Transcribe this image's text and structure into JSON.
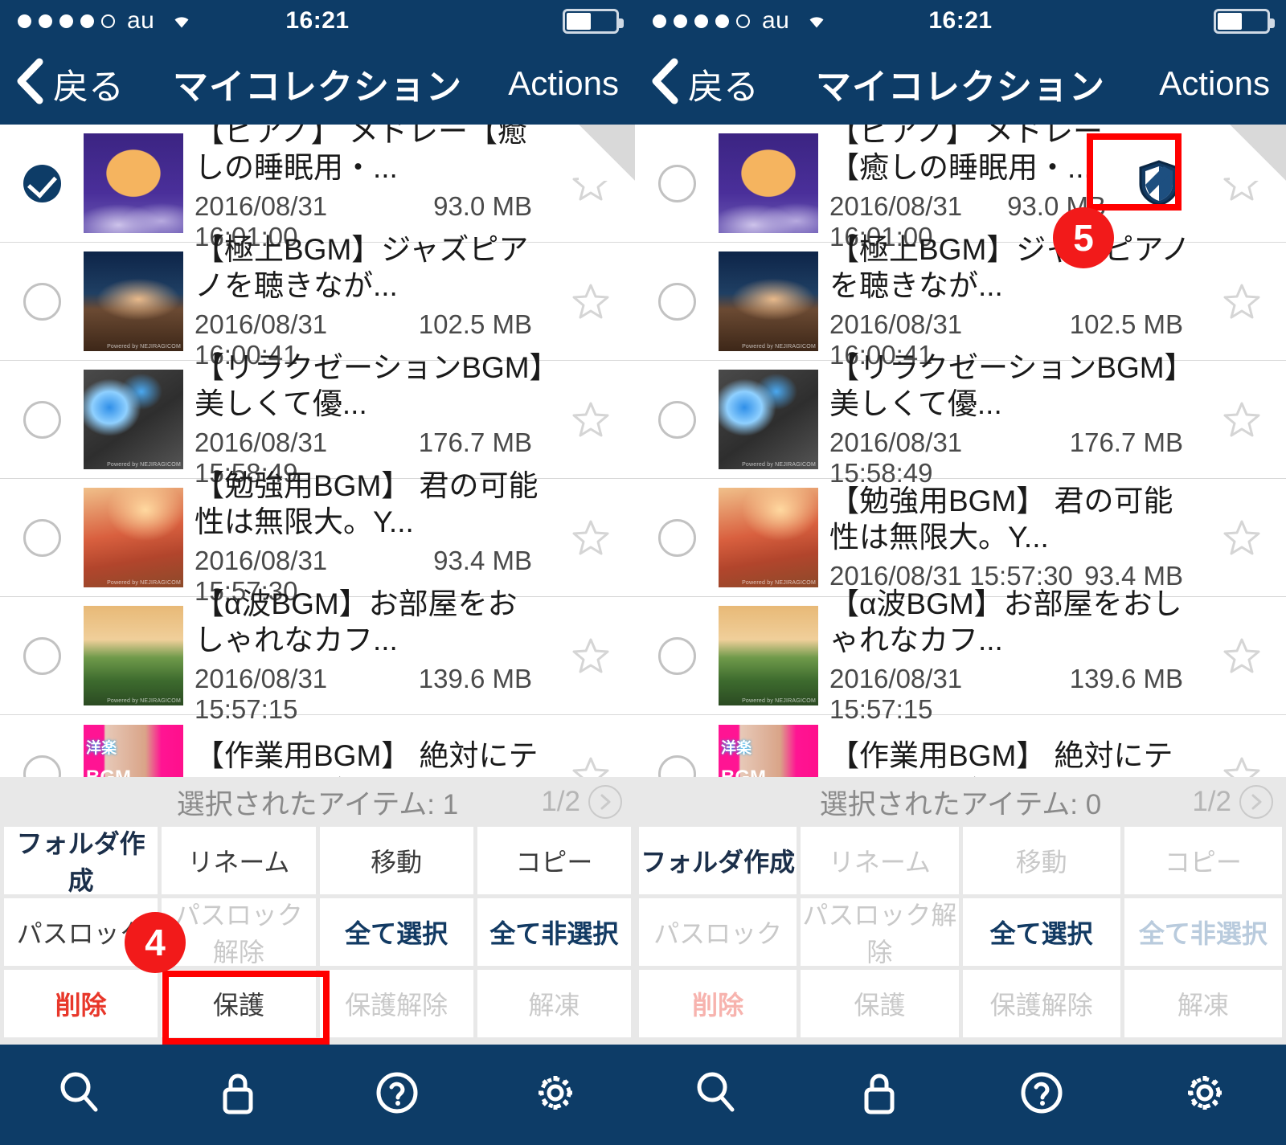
{
  "status_bar": {
    "carrier": "au",
    "time": "16:21",
    "signal_dots_filled": 4,
    "signal_dots_total": 5,
    "battery_percent": 50,
    "wifi_icon": "wifi-icon",
    "battery_icon": "battery-icon"
  },
  "nav": {
    "back_label": "戻る",
    "title": "マイコレクション",
    "actions_label": "Actions",
    "back_icon": "chevron-left-icon"
  },
  "colors": {
    "navy": "#0d3c67",
    "panel_bg": "#e8e8e8",
    "highlight_red": "#ff0000",
    "danger_red": "#e8372a",
    "accent_blue": "#123a63"
  },
  "items": [
    {
      "title": "【ピアノ】 メドレー【癒しの睡眠用・...",
      "date": "2016/08/31 16:01:00",
      "size": "93.0 MB",
      "selected_left": true,
      "selected_right": false,
      "protected_right": true,
      "star_icon": "star-outline-icon",
      "shield_icon": "shield-protected-icon",
      "thumb": "moon-night"
    },
    {
      "title": "【極上BGM】ジャズピアノを聴きなが...",
      "date": "2016/08/31 16:00:41",
      "size": "102.5 MB",
      "selected_left": false,
      "selected_right": false,
      "protected_right": false,
      "star_icon": "star-outline-icon",
      "thumb": "terrace-dusk"
    },
    {
      "title": "【リラクゼーションBGM】美しくて優...",
      "date": "2016/08/31 15:58:49",
      "size": "176.7 MB",
      "selected_left": false,
      "selected_right": false,
      "protected_right": false,
      "star_icon": "star-outline-icon",
      "thumb": "blue-orchid"
    },
    {
      "title": "【勉強用BGM】 君の可能性は無限大。Y...",
      "date": "2016/08/31 15:57:30",
      "size": "93.4 MB",
      "selected_left": false,
      "selected_right": false,
      "protected_right": false,
      "star_icon": "star-outline-icon",
      "thumb": "desk-warm"
    },
    {
      "title": "【α波BGM】お部屋をおしゃれなカフ...",
      "date": "2016/08/31 15:57:15",
      "size": "139.6 MB",
      "selected_left": false,
      "selected_right": false,
      "protected_right": false,
      "star_icon": "star-outline-icon",
      "thumb": "cafe-landscape"
    },
    {
      "title": "【作業用BGM】 絶対にテンションが",
      "date": "",
      "size": "",
      "selected_left": false,
      "selected_right": false,
      "protected_right": false,
      "star_icon": "star-outline-icon",
      "thumb": "pink-idol"
    }
  ],
  "action_panel_left": {
    "count_label": "選択されたアイテム: 1",
    "page_label": "1/2",
    "next_icon": "chevron-right-circle-icon",
    "buttons": [
      {
        "label": "フォルダ作成",
        "state": "bold"
      },
      {
        "label": "リネーム",
        "state": "normal"
      },
      {
        "label": "移動",
        "state": "normal"
      },
      {
        "label": "コピー",
        "state": "normal"
      },
      {
        "label": "パスロック",
        "state": "normal"
      },
      {
        "label": "パスロック解除",
        "state": "dim"
      },
      {
        "label": "全て選択",
        "state": "blue"
      },
      {
        "label": "全て非選択",
        "state": "blue"
      },
      {
        "label": "削除",
        "state": "red"
      },
      {
        "label": "保護",
        "state": "normal"
      },
      {
        "label": "保護解除",
        "state": "dim"
      },
      {
        "label": "解凍",
        "state": "dim"
      }
    ]
  },
  "action_panel_right": {
    "count_label": "選択されたアイテム: 0",
    "page_label": "1/2",
    "next_icon": "chevron-right-circle-icon",
    "buttons": [
      {
        "label": "フォルダ作成",
        "state": "bold"
      },
      {
        "label": "リネーム",
        "state": "dim"
      },
      {
        "label": "移動",
        "state": "dim"
      },
      {
        "label": "コピー",
        "state": "dim"
      },
      {
        "label": "パスロック",
        "state": "dim"
      },
      {
        "label": "パスロック解除",
        "state": "dim"
      },
      {
        "label": "全て選択",
        "state": "blue"
      },
      {
        "label": "全て非選択",
        "state": "dim blue"
      },
      {
        "label": "削除",
        "state": "dim red"
      },
      {
        "label": "保護",
        "state": "dim"
      },
      {
        "label": "保護解除",
        "state": "dim"
      },
      {
        "label": "解凍",
        "state": "dim"
      }
    ]
  },
  "tabbar": {
    "items": [
      {
        "icon": "search-icon"
      },
      {
        "icon": "lock-icon"
      },
      {
        "icon": "help-circle-icon"
      },
      {
        "icon": "gear-icon"
      }
    ]
  },
  "annotations": [
    {
      "number": "4",
      "target": "保護ボタン"
    },
    {
      "number": "5",
      "target": "保護アイコン"
    }
  ]
}
